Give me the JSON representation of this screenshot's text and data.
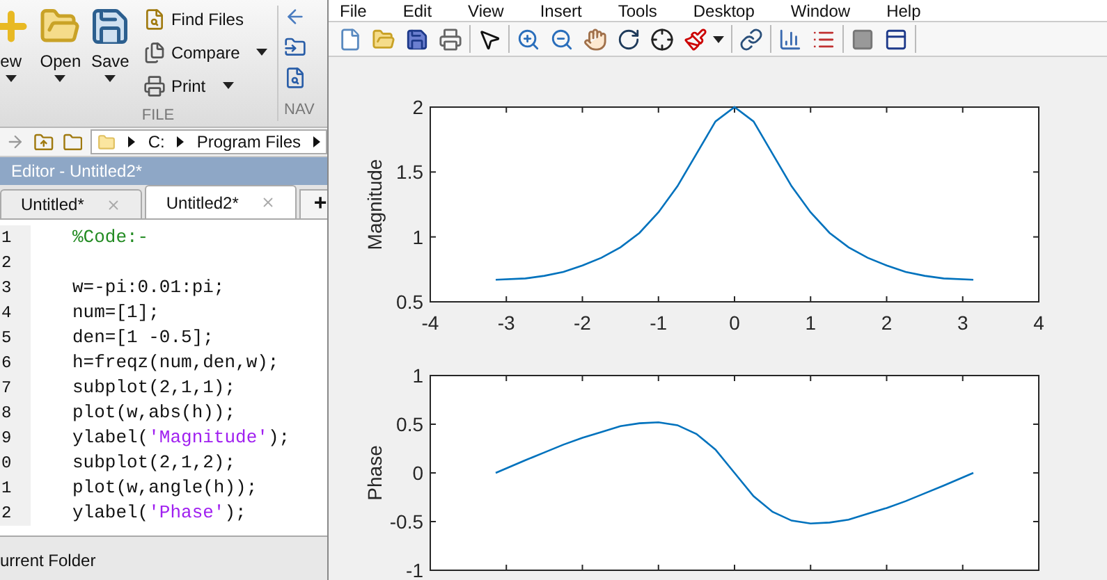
{
  "toolstrip": {
    "buttons": [
      {
        "kind": "new",
        "label": "ew"
      },
      {
        "kind": "open",
        "label": "Open"
      },
      {
        "kind": "save",
        "label": "Save"
      }
    ],
    "small_buttons": [
      {
        "kind": "find",
        "label": "Find Files",
        "dropdown": false
      },
      {
        "kind": "compare",
        "label": "Compare",
        "dropdown": true
      },
      {
        "kind": "print",
        "label": "Print",
        "dropdown": true
      }
    ],
    "sections": [
      "FILE",
      "NAV"
    ]
  },
  "address_bar": {
    "path": [
      "C:",
      "Program Files"
    ]
  },
  "editor": {
    "title": "Editor - Untitled2*",
    "tabs": [
      {
        "label": "Untitled*",
        "selected": false
      },
      {
        "label": "Untitled2*",
        "selected": true
      }
    ],
    "new_tab": "+",
    "lines": [
      {
        "number": "1",
        "segments": [
          {
            "kind": "comment",
            "text": "%Code:-"
          }
        ]
      },
      {
        "number": "2"
      },
      {
        "number": "3",
        "segments": [
          {
            "kind": "code",
            "text": "w=-pi:0.01:pi;"
          }
        ]
      },
      {
        "number": "4",
        "segments": [
          {
            "kind": "code",
            "text": "num=[1];"
          }
        ]
      },
      {
        "number": "5",
        "segments": [
          {
            "kind": "code",
            "text": "den=[1 -0.5];"
          }
        ]
      },
      {
        "number": "6",
        "segments": [
          {
            "kind": "code",
            "text": "h=freqz(num,den,w);"
          }
        ]
      },
      {
        "number": "7",
        "segments": [
          {
            "kind": "code",
            "text": "subplot(2,1,1);"
          }
        ]
      },
      {
        "number": "8",
        "segments": [
          {
            "kind": "code",
            "text": "plot(w,abs(h));"
          }
        ]
      },
      {
        "number": "9",
        "segments": [
          {
            "kind": "code",
            "text": "ylabel("
          },
          {
            "kind": "string",
            "text": "'Magnitude'"
          },
          {
            "kind": "code",
            "text": ");"
          }
        ]
      },
      {
        "number": "0",
        "segments": [
          {
            "kind": "code",
            "text": "subplot(2,1,2);"
          }
        ]
      },
      {
        "number": "1",
        "segments": [
          {
            "kind": "code",
            "text": "plot(w,angle(h));"
          }
        ]
      },
      {
        "number": "2",
        "segments": [
          {
            "kind": "code",
            "text": "ylabel("
          },
          {
            "kind": "string",
            "text": "'Phase'"
          },
          {
            "kind": "code",
            "text": ");"
          }
        ]
      }
    ]
  },
  "current_folder": {
    "title": "urrent Folder"
  },
  "figure": {
    "menu": [
      "File",
      "Edit",
      "View",
      "Insert",
      "Tools",
      "Desktop",
      "Window",
      "Help"
    ],
    "toolbar": [
      {
        "tools": [
          {
            "kind": "new"
          },
          {
            "kind": "open"
          },
          {
            "kind": "save"
          },
          {
            "kind": "print"
          }
        ]
      },
      {
        "tools": [
          {
            "kind": "pointer"
          }
        ]
      },
      {
        "tools": [
          {
            "kind": "zoom-in"
          },
          {
            "kind": "zoom-out"
          },
          {
            "kind": "pan"
          },
          {
            "kind": "rotate"
          },
          {
            "kind": "data-cursor"
          },
          {
            "kind": "brush"
          }
        ]
      },
      {
        "tools": [
          {
            "kind": "link"
          }
        ]
      },
      {
        "tools": [
          {
            "kind": "colorbar"
          },
          {
            "kind": "legend"
          }
        ]
      },
      {
        "tools": [
          {
            "kind": "hide-tools"
          },
          {
            "kind": "show-tools"
          }
        ]
      }
    ],
    "axes": [
      {
        "chart_data": {
          "type": "line",
          "ylabel": "Magnitude",
          "xlim": [
            -4,
            4
          ],
          "ylim": [
            0.5,
            2
          ],
          "xticks": [
            -4,
            -3,
            -2,
            -1,
            0,
            1,
            2,
            3,
            4
          ],
          "yticks": [
            0.5,
            1,
            1.5,
            2
          ],
          "x": [
            -3.14,
            -2.75,
            -2.5,
            -2.25,
            -2,
            -1.75,
            -1.5,
            -1.25,
            -1,
            -0.75,
            -0.5,
            -0.25,
            0,
            0.25,
            0.5,
            0.75,
            1,
            1.25,
            1.5,
            1.75,
            2,
            2.25,
            2.5,
            2.75,
            3.14
          ],
          "series": [
            {
              "color": "#0072bd",
              "values": [
                0.67,
                0.68,
                0.7,
                0.73,
                0.78,
                0.84,
                0.92,
                1.03,
                1.19,
                1.39,
                1.64,
                1.89,
                2.0,
                1.89,
                1.64,
                1.39,
                1.19,
                1.03,
                0.92,
                0.84,
                0.78,
                0.73,
                0.7,
                0.68,
                0.67
              ]
            }
          ]
        }
      },
      {
        "chart_data": {
          "type": "line",
          "ylabel": "Phase",
          "xlim": [
            -4,
            4
          ],
          "ylim": [
            -1,
            1
          ],
          "yticks": [
            -1,
            -0.5,
            0,
            0.5,
            1
          ],
          "x": [
            -3.14,
            -2.75,
            -2.5,
            -2.25,
            -2,
            -1.75,
            -1.5,
            -1.25,
            -1,
            -0.75,
            -0.5,
            -0.25,
            0,
            0.25,
            0.5,
            0.75,
            1,
            1.25,
            1.5,
            1.75,
            2,
            2.25,
            2.5,
            2.75,
            3.14
          ],
          "series": [
            {
              "color": "#0072bd",
              "values": [
                0.0,
                0.13,
                0.21,
                0.29,
                0.36,
                0.42,
                0.48,
                0.51,
                0.52,
                0.49,
                0.4,
                0.24,
                0,
                -0.24,
                -0.4,
                -0.49,
                -0.52,
                -0.51,
                -0.48,
                -0.42,
                -0.36,
                -0.29,
                -0.21,
                -0.13,
                0.0
              ]
            }
          ]
        }
      }
    ]
  }
}
